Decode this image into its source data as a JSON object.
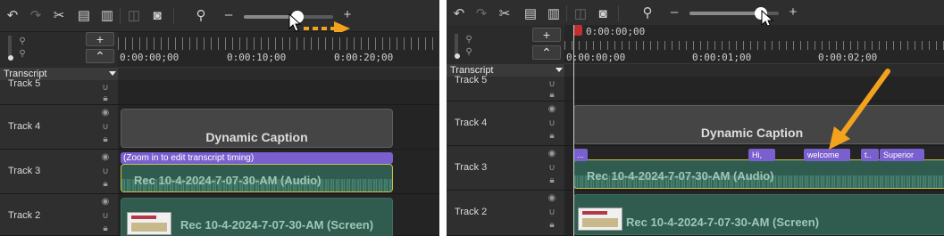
{
  "left": {
    "zoom_minus": "–",
    "zoom_plus": "+",
    "zoom_level_fraction": 0.6,
    "add_track": "+",
    "collapse": "⌃",
    "transcript_label": "Transcript",
    "ruler": [
      "0:00:00;00",
      "0:00:10;00",
      "0:00:20;00"
    ],
    "tracks": [
      {
        "name": "Track 5"
      },
      {
        "name": "Track 4",
        "clip": "Dynamic Caption"
      },
      {
        "name": "Track 3",
        "transcript_bar": "(Zoom in to edit transcript timing)",
        "clip": "Rec 10-4-2024-7-07-30-AM (Audio)"
      },
      {
        "name": "Track 2",
        "clip": "Rec 10-4-2024-7-07-30-AM (Screen)"
      }
    ]
  },
  "right": {
    "zoom_minus": "–",
    "zoom_plus": "+",
    "zoom_level_fraction": 0.8,
    "add_track": "+",
    "collapse": "⌃",
    "transcript_label": "Transcript",
    "playhead_time": "0:00:00;00",
    "ruler": [
      "0:00:00;00",
      "0:00:01;00",
      "0:00:02;00"
    ],
    "tracks": [
      {
        "name": "Track 5"
      },
      {
        "name": "Track 4",
        "clip": "Dynamic Caption"
      },
      {
        "name": "Track 3",
        "words": [
          "...",
          "Hi,",
          "welcome",
          "t..",
          "Superior"
        ],
        "clip": "Rec 10-4-2024-7-07-30-AM (Audio)"
      },
      {
        "name": "Track 2",
        "clip": "Rec 10-4-2024-7-07-30-AM (Screen)"
      }
    ]
  },
  "colors": {
    "accent_arrow": "#f2a21d",
    "transcript_purple": "#7a5fcf",
    "audio_border": "#c9c04a",
    "clip_green": "#2f5c4e"
  },
  "icons": [
    "undo-icon",
    "redo-icon",
    "cut-icon",
    "copy-icon",
    "paste-icon",
    "split-icon",
    "snapshot-icon",
    "zoom-icon",
    "eye-icon",
    "magnet-icon",
    "lock-icon",
    "cursor-icon"
  ]
}
